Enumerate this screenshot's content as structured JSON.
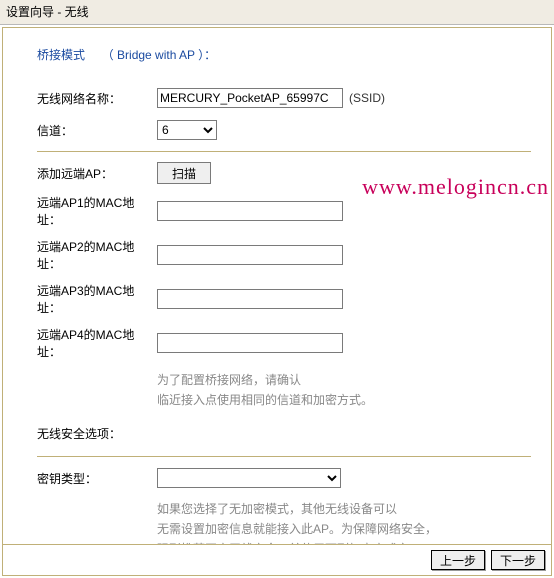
{
  "window": {
    "title": "设置向导 - 无线"
  },
  "heading": {
    "mode_label": "桥接模式",
    "mode_en": "（ Bridge with AP ）："
  },
  "form": {
    "ssid_label": "无线网络名称：",
    "ssid_value": "MERCURY_PocketAP_65997C",
    "ssid_suffix": "(SSID)",
    "channel_label": "信道：",
    "channel_value": "6",
    "add_ap_label": "添加远端AP：",
    "scan_label": "扫描",
    "mac1_label": "远端AP1的MAC地址：",
    "mac1_value": "",
    "mac2_label": "远端AP2的MAC地址：",
    "mac2_value": "",
    "mac3_label": "远端AP3的MAC地址：",
    "mac3_value": "",
    "mac4_label": "远端AP4的MAC地址：",
    "mac4_value": "",
    "bridge_hint1": "为了配置桥接网络，请确认",
    "bridge_hint2": "临近接入点使用相同的信道和加密方式。",
    "security_label": "无线安全选项：",
    "keytype_label": "密钥类型：",
    "keytype_value": "",
    "keytype_hint1": "如果您选择了无加密模式，其他无线设备可以",
    "keytype_hint2": "无需设置加密信息就能接入此AP。为保障网络安全，",
    "keytype_hint3": "强烈推荐开启无线安全，并使用下列加密方式之一。"
  },
  "footer": {
    "prev_label": "上一步",
    "next_label": "下一步"
  },
  "watermark": "www.melogincn.cn"
}
